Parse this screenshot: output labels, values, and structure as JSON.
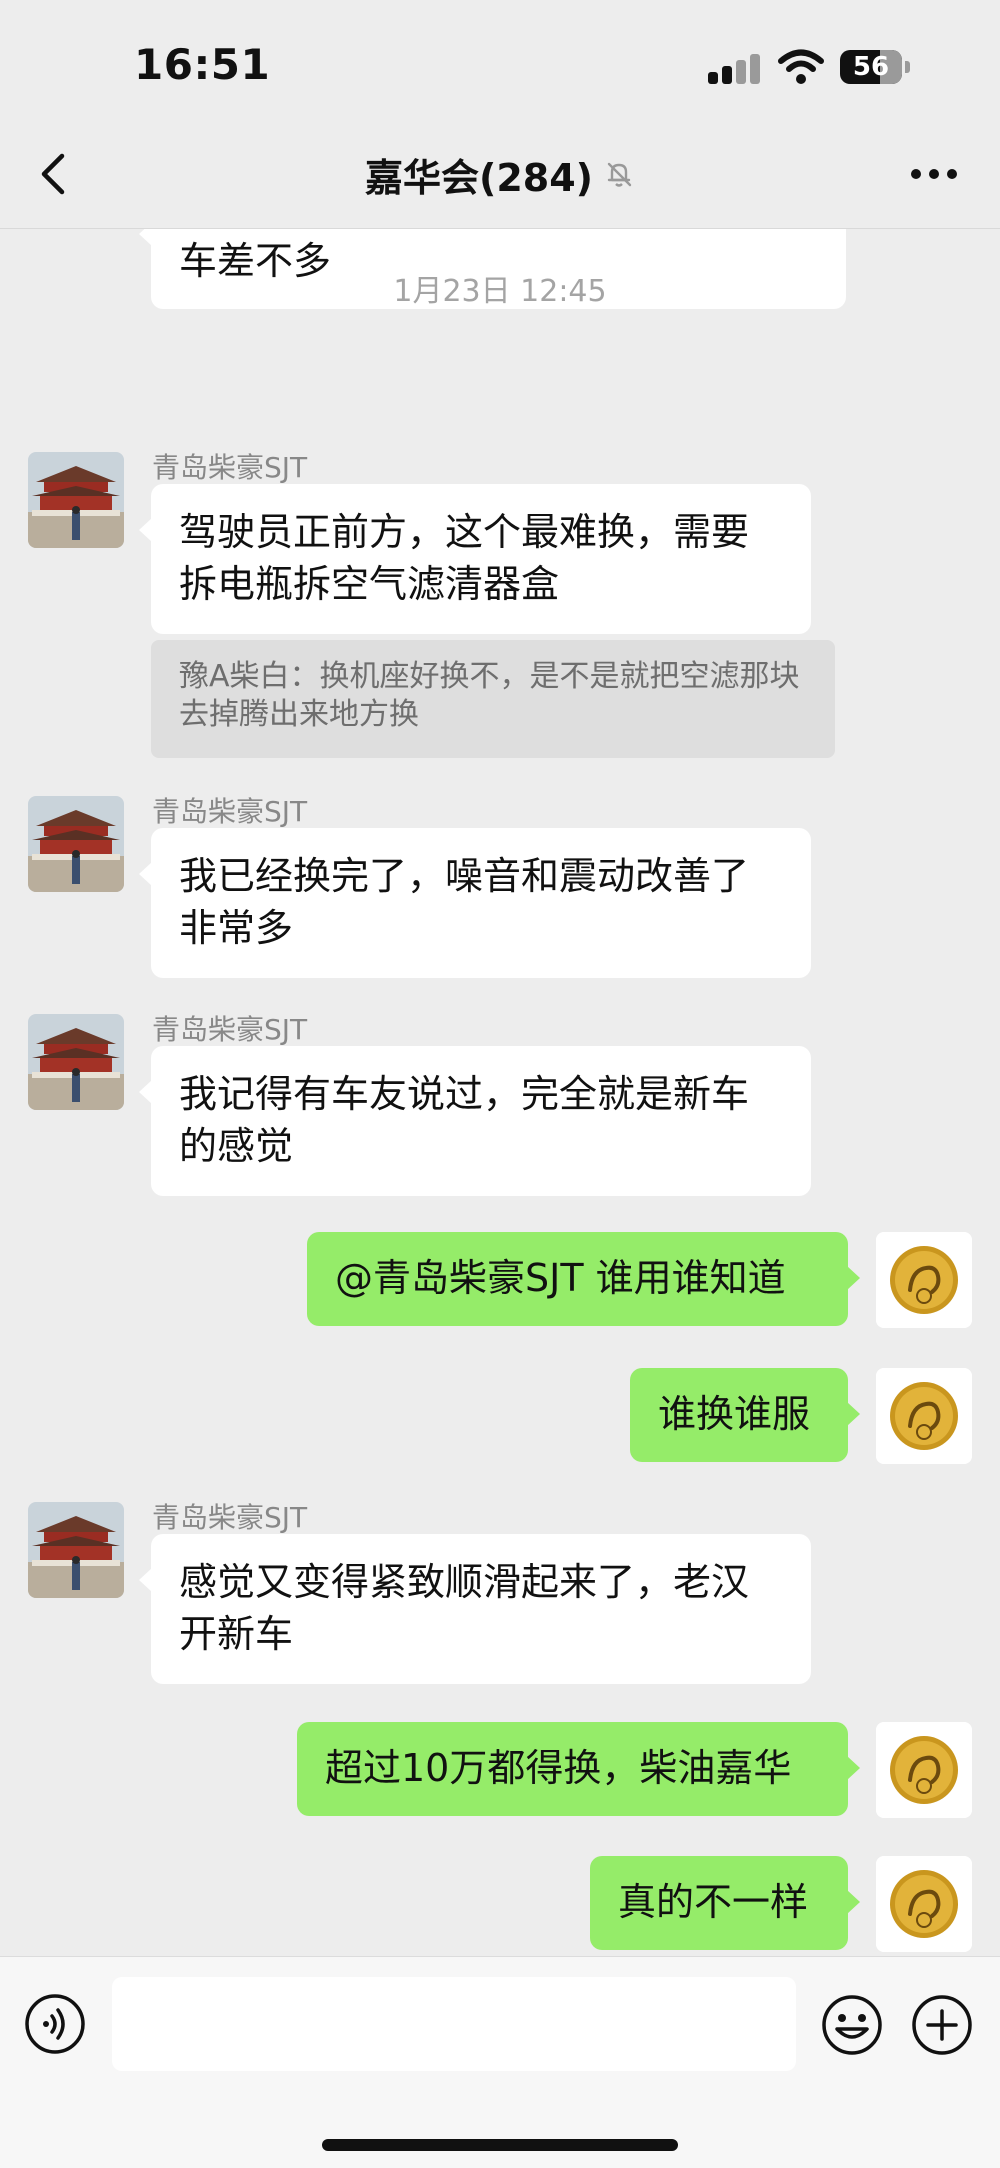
{
  "status_bar": {
    "time": "16:51",
    "battery": "56"
  },
  "header": {
    "title": "嘉华会(284)",
    "back_icon": "chevron-left-icon",
    "mute_icon": "bell-slash-icon",
    "more_icon": "ellipsis-icon"
  },
  "chat": {
    "partial_message": {
      "text": "车差不多"
    },
    "timestamp": "1月23日 12:45",
    "messages": [
      {
        "sender": "青岛柴豪SJT",
        "text": "驾驶员正前方，这个最难换，需要拆电瓶拆空气滤清器盒",
        "quote": "豫A柴白：换机座好换不，是不是就把空滤那块去掉腾出来地方换"
      },
      {
        "sender": "青岛柴豪SJT",
        "text": "我已经换完了，噪音和震动改善了非常多"
      },
      {
        "sender": "青岛柴豪SJT",
        "text": "我记得有车友说过，完全就是新车的感觉"
      },
      {
        "text": "@青岛柴豪SJT 谁用谁知道"
      },
      {
        "text": "谁换谁服"
      },
      {
        "sender": "青岛柴豪SJT",
        "text": "感觉又变得紧致顺滑起来了，老汉开新车"
      },
      {
        "text": "超过10万都得换，柴油嘉华"
      },
      {
        "text": "真的不一样"
      }
    ]
  },
  "input_bar": {
    "placeholder": "",
    "voice_icon": "voice-icon",
    "emoji_icon": "emoji-icon",
    "plus_icon": "plus-icon"
  },
  "colors": {
    "background": "#EDEDED",
    "self_bubble": "#95EC69",
    "other_bubble": "#FFFFFF",
    "quote_bg": "#DEDEDE"
  }
}
